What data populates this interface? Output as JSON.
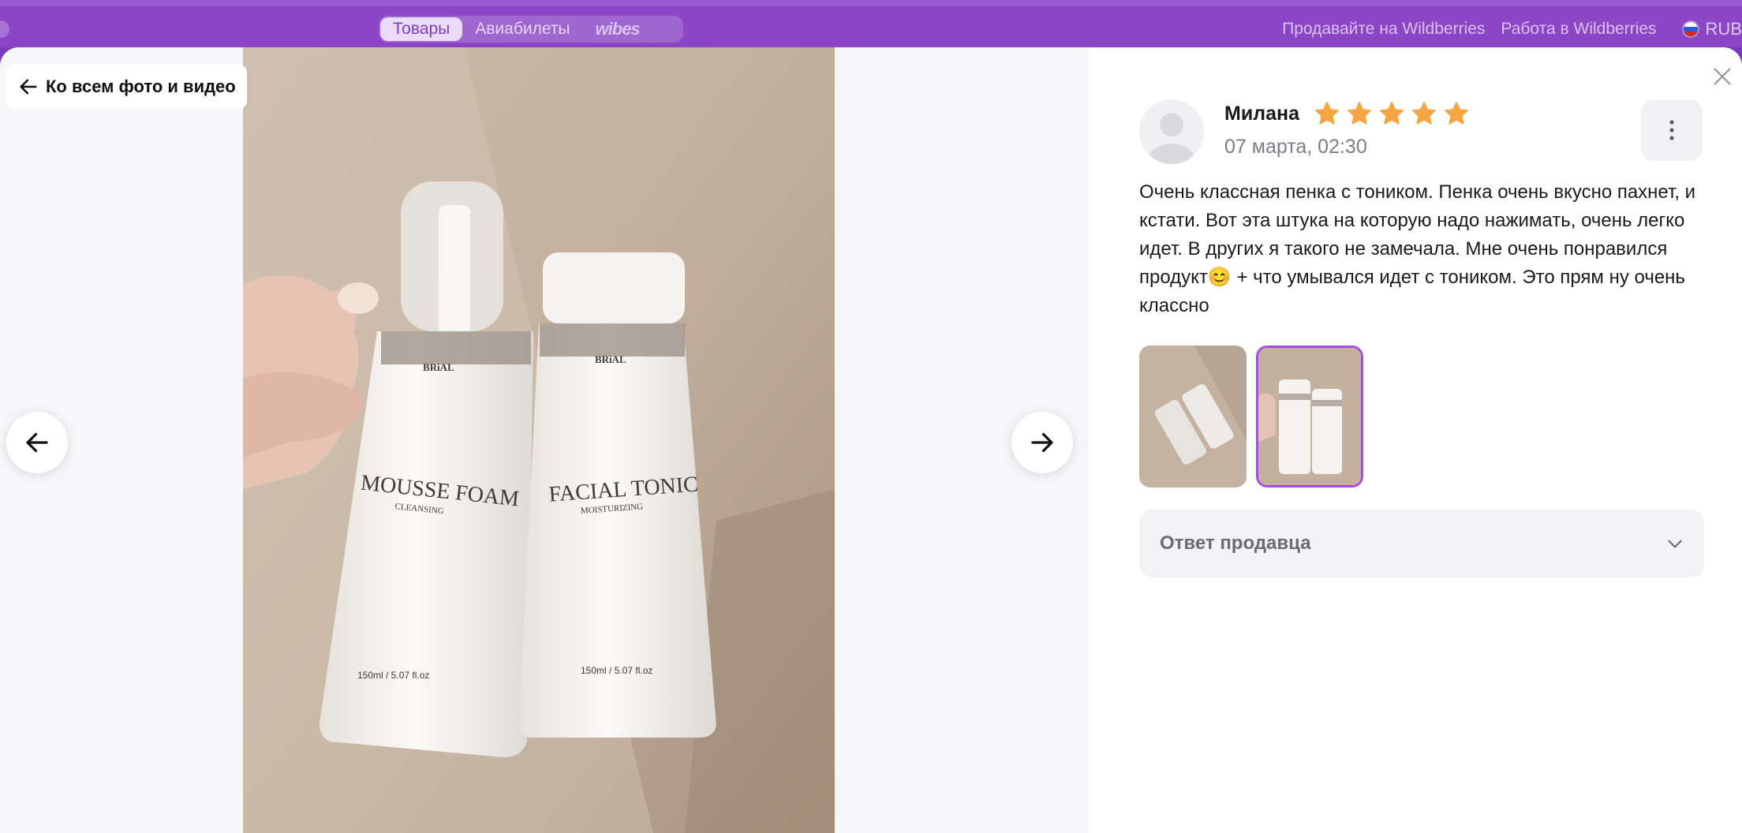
{
  "header": {
    "tabs": [
      "Товары",
      "Авиабилеты",
      "wibes"
    ],
    "links": [
      "Продавайте на Wildberries",
      "Работа в Wildberries"
    ],
    "lang": "RUB"
  },
  "viewer": {
    "back_label": "Ко всем фото и видео",
    "photo_labels": {
      "brand1": "BRiAL",
      "product1": "MOUSSE FOAM",
      "sub1": "CLEANSING",
      "vol1": "150ml / 5.07 fl.oz",
      "brand2": "BRiAL",
      "product2": "FACIAL TONIC",
      "sub2": "MOISTURIZING",
      "vol2": "150ml / 5.07 fl.oz"
    }
  },
  "review": {
    "author": "Милана",
    "rating": 5,
    "date": "07 марта, 02:30",
    "text": "Очень классная пенка с тоником. Пенка очень вкусно пахнет, и кстати. Вот эта штука на которую надо нажимать, очень легко идет. В других я такого не замечала. Мне очень понравился продукт😊 + что умывался идет с тоником. Это прям ну очень классно",
    "seller_reply_label": "Ответ продавца"
  },
  "colors": {
    "brand": "#8a44c4",
    "star": "#f7a541",
    "thumb_active": "#a44ee8"
  }
}
